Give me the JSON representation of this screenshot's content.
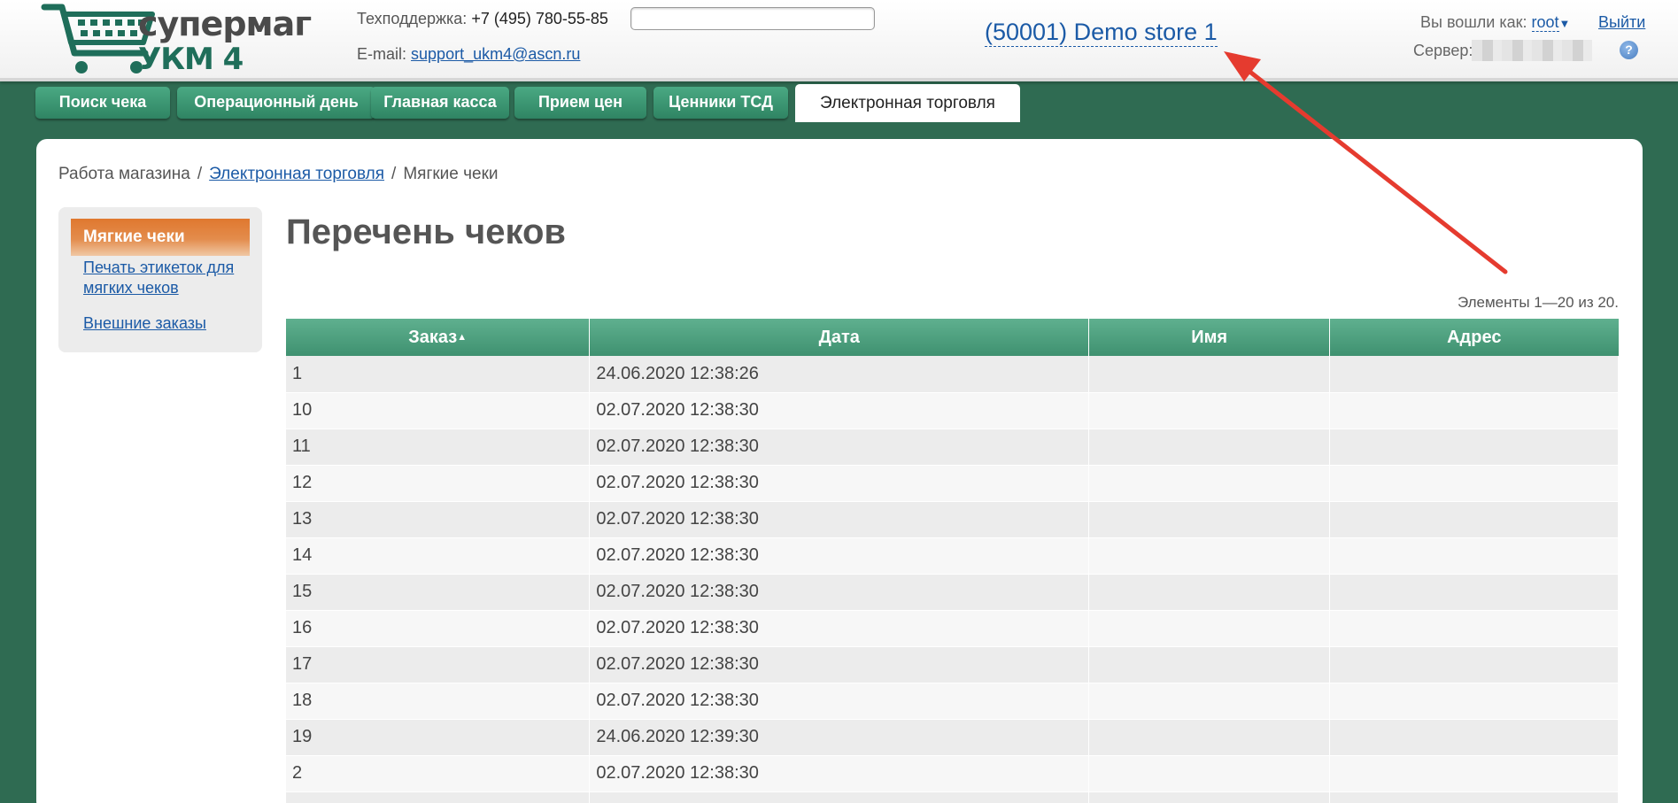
{
  "header": {
    "logo_line1": "супермаг",
    "logo_line2": "УКМ 4",
    "support_label": "Техподдержка:",
    "support_phone": "+7 (495) 780-55-85",
    "email_label": "E-mail:",
    "email_value": "support_ukm4@ascn.ru",
    "search_value": "",
    "store_name": "(50001) Demo store 1",
    "login_label": "Вы вошли как:",
    "login_user": "root",
    "logout_label": "Выйти",
    "server_label": "Сервер:",
    "help_label": "?"
  },
  "tabs": [
    {
      "label": "Поиск чека"
    },
    {
      "label": "Операционный день"
    },
    {
      "label": "Главная касса"
    },
    {
      "label": "Прием цен"
    },
    {
      "label": "Ценники ТСД"
    },
    {
      "label": "Электронная торговля",
      "active": true
    }
  ],
  "breadcrumb": {
    "root": "Работа магазина",
    "link": "Электронная торговля",
    "current": "Мягкие чеки"
  },
  "sidebar": {
    "active": "Мягкие чеки",
    "link1": "Печать этикеток для мягких чеков",
    "link2": "Внешние заказы"
  },
  "main": {
    "title": "Перечень чеков",
    "count": "Элементы 1—20 из 20."
  },
  "table": {
    "columns": [
      "Заказ",
      "Дата",
      "Имя",
      "Адрес"
    ],
    "sort_indicator": "▲",
    "rows": [
      [
        "1",
        "24.06.2020 12:38:26",
        "",
        ""
      ],
      [
        "10",
        "02.07.2020 12:38:30",
        "",
        ""
      ],
      [
        "11",
        "02.07.2020 12:38:30",
        "",
        ""
      ],
      [
        "12",
        "02.07.2020 12:38:30",
        "",
        ""
      ],
      [
        "13",
        "02.07.2020 12:38:30",
        "",
        ""
      ],
      [
        "14",
        "02.07.2020 12:38:30",
        "",
        ""
      ],
      [
        "15",
        "02.07.2020 12:38:30",
        "",
        ""
      ],
      [
        "16",
        "02.07.2020 12:38:30",
        "",
        ""
      ],
      [
        "17",
        "02.07.2020 12:38:30",
        "",
        ""
      ],
      [
        "18",
        "02.07.2020 12:38:30",
        "",
        ""
      ],
      [
        "19",
        "24.06.2020 12:39:30",
        "",
        ""
      ],
      [
        "2",
        "02.07.2020 12:38:30",
        "",
        ""
      ],
      [
        "",
        "",
        "",
        ""
      ]
    ]
  },
  "colors": {
    "background": "#2f6b52",
    "tab": "#3a9572",
    "accent_orange": "#e0782f",
    "link": "#1b5aa6",
    "annotation_arrow": "#e53b2f"
  }
}
